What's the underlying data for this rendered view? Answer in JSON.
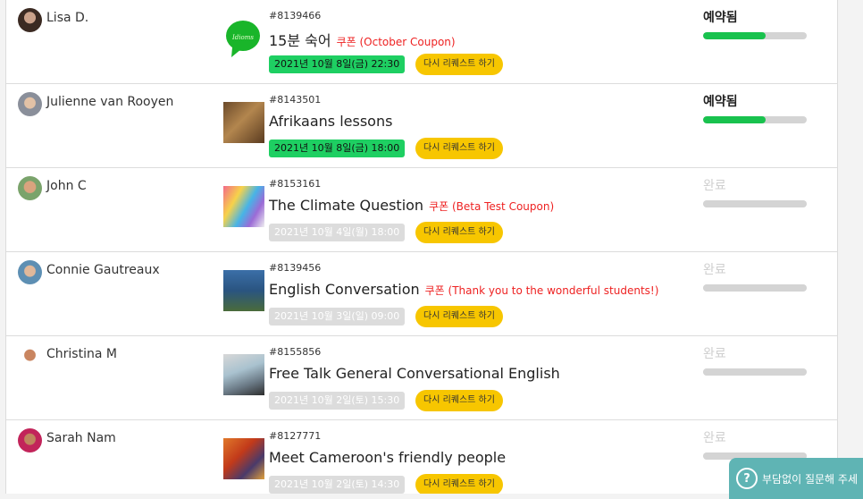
{
  "lessons": [
    {
      "teacher": "Lisa D.",
      "order_id": "#8139466",
      "title": "15분 숙어",
      "coupon": "쿠폰 (October Coupon)",
      "date": "2021년 10월 8일(금) 22:30",
      "date_active": true,
      "rerequest": "다시 리퀘스트 하기",
      "status": "예약됨",
      "progress": 0.6
    },
    {
      "teacher": "Julienne van Rooyen",
      "order_id": "#8143501",
      "title": "Afrikaans lessons",
      "coupon": "",
      "date": "2021년 10월 8일(금) 18:00",
      "date_active": true,
      "rerequest": "다시 리퀘스트 하기",
      "status": "예약됨",
      "progress": 0.6
    },
    {
      "teacher": "John C",
      "order_id": "#8153161",
      "title": "The Climate Question",
      "coupon": "쿠폰 (Beta Test Coupon)",
      "date": "2021년 10월 4일(월) 18:00",
      "date_active": false,
      "rerequest": "다시 리퀘스트 하기",
      "status": "완료",
      "progress": 1
    },
    {
      "teacher": "Connie Gautreaux",
      "order_id": "#8139456",
      "title": "English Conversation",
      "coupon": "쿠폰 (Thank you to the wonderful students!)",
      "date": "2021년 10월 3일(일) 09:00",
      "date_active": false,
      "rerequest": "다시 리퀘스트 하기",
      "status": "완료",
      "progress": 1
    },
    {
      "teacher": "Christina M",
      "order_id": "#8155856",
      "title": "Free Talk General Conversational English",
      "coupon": "",
      "date": "2021년 10월 2일(토) 15:30",
      "date_active": false,
      "rerequest": "다시 리퀘스트 하기",
      "status": "완료",
      "progress": 1
    },
    {
      "teacher": "Sarah Nam",
      "order_id": "#8127771",
      "title": "Meet Cameroon's friendly people",
      "coupon": "",
      "date": "2021년 10월 2일(토) 14:30",
      "date_active": false,
      "rerequest": "다시 리퀘스트 하기",
      "status": "완료",
      "progress": 1
    }
  ],
  "help_button": {
    "label": "부담없이 질문해 주세"
  },
  "colors": {
    "progress_active": "#19c24e",
    "progress_track": "#d4d4d4",
    "rerequest_bg": "#f7c600",
    "date_active": "#1ecf62",
    "coupon": "#e22222"
  }
}
